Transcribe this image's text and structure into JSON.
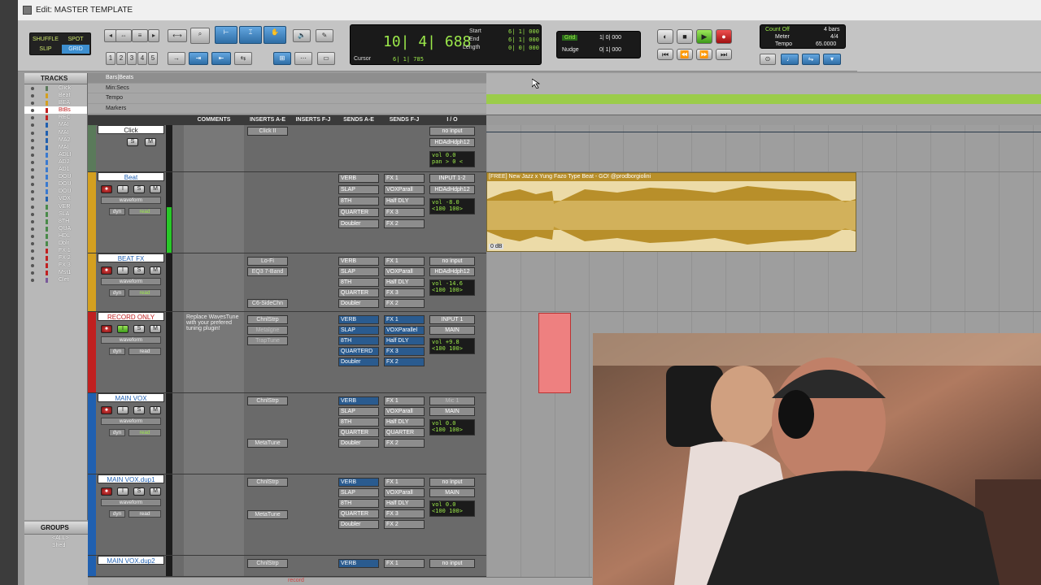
{
  "window": {
    "title": "Edit: MASTER TEMPLATE"
  },
  "modes": {
    "shuffle": "SHUFFLE",
    "spot": "SPOT",
    "slip": "SLIP",
    "grid": "GRID"
  },
  "zoom_presets": [
    "1",
    "2",
    "3",
    "4",
    "5"
  ],
  "counter": {
    "main": "10| 4| 688",
    "start_label": "Start",
    "end_label": "End",
    "length_label": "Length",
    "start": "6| 1| 000",
    "end": "6| 1| 000",
    "length": "0| 0| 000",
    "cursor_label": "Cursor",
    "cursor": "6| 1| 785"
  },
  "grid": {
    "label": "Grid",
    "value": "1| 0| 000",
    "nudge_label": "Nudge",
    "nudge_value": "0| 1| 000"
  },
  "countoff": {
    "label": "Count Off",
    "bars": "4 bars",
    "meter_label": "Meter",
    "meter": "4/4",
    "tempo_label": "Tempo",
    "tempo": "65.0000"
  },
  "tracks_panel": {
    "title": "TRACKS",
    "items": [
      "Click",
      "Beat",
      "BEA",
      "BtBs",
      "REC",
      "MAI",
      "MAI",
      "MA2",
      "MAI",
      "ADLI",
      "AD2",
      "AD1",
      "DOU",
      "DOU",
      "DOU",
      "VOX",
      "VER",
      "SLA",
      "8TH",
      "QUA",
      "HDL",
      "Dblr",
      "FX 1",
      "FX 2",
      "FX 3",
      "Mst1",
      "Clet"
    ]
  },
  "groups_panel": {
    "title": "GROUPS",
    "items": [
      "<ALL>",
      "Shed"
    ]
  },
  "rulers": [
    "Bars|Beats",
    "Min:Secs",
    "Tempo",
    "Markers"
  ],
  "columns": {
    "comments": "COMMENTS",
    "inserts_ae": "INSERTS A-E",
    "inserts_fj": "INSERTS F-J",
    "sends_ae": "SENDS A-E",
    "sends_fj": "SENDS F-J",
    "io": "I / O"
  },
  "tracks": [
    {
      "name": "Click",
      "color": "#6a6a6a",
      "comment": "",
      "inserts": [
        "Click II"
      ],
      "sends": [],
      "io_in": "no input",
      "io_out": "HDAdHdph12",
      "vol": "0.0",
      "pan": "> 0 <"
    },
    {
      "name": "Beat",
      "color": "#d4a020",
      "comment": "",
      "view": "waveform",
      "mode": "read",
      "inserts": [],
      "sends_a": [
        "VERB",
        "SLAP",
        "8TH",
        "QUARTER",
        "Doubler"
      ],
      "sends_f": [
        "FX 1",
        "VOXParall",
        "Half DLY",
        "FX 3",
        "FX 2"
      ],
      "io_in": "INPUT 1-2",
      "io_out": "HDAdHdph12",
      "vol": "-8.0",
      "pan": "<100   100>"
    },
    {
      "name": "BEAT FX",
      "color": "#d4a020",
      "comment": "",
      "view": "waveform",
      "mode": "read",
      "inserts": [
        "Lo-Fi",
        "EQ3 7-Band",
        "",
        "",
        "C6-SideChn"
      ],
      "sends_a": [
        "VERB",
        "SLAP",
        "8TH",
        "QUARTER",
        "Doubler"
      ],
      "sends_f": [
        "FX 1",
        "VOXParall",
        "Half DLY",
        "FX 3",
        "FX 2"
      ],
      "io_in": "no input",
      "io_out": "HDAdHdph12",
      "vol": "-14.6",
      "pan": "<100   100>"
    },
    {
      "name": "RECORD ONLY",
      "color": "#c02020",
      "comment": "Replace WavesTune with your prefered tuning plugin!",
      "view": "waveform",
      "mode": "read",
      "inserts": [
        "ChnlStrp",
        "Metalgne",
        "TrapTune"
      ],
      "sends_a": [
        "VERB",
        "SLAP",
        "8TH",
        "QUARTERD",
        "Doubler"
      ],
      "sends_f": [
        "FX 1",
        "VOXParallel",
        "Half DLY",
        "FX 3",
        "FX 2"
      ],
      "io_in": "INPUT 1",
      "io_out": "MAIN",
      "vol": "+9.8",
      "pan": "<100   100>"
    },
    {
      "name": "MAIN VOX",
      "color": "#2060b0",
      "comment": "",
      "view": "waveform",
      "mode": "read",
      "inserts": [
        "ChnlStrp",
        "",
        "",
        "",
        "MetaTune"
      ],
      "sends_a": [
        "VERB",
        "SLAP",
        "8TH",
        "QUARTER",
        "Doubler"
      ],
      "sends_f": [
        "FX 1",
        "VOXParall",
        "Half DLY",
        "QUARTER",
        "FX 2"
      ],
      "io_in": "Mic 1",
      "io_out": "MAIN",
      "vol": "0.0",
      "pan": "<100   100>"
    },
    {
      "name": "MAIN VOX.dup1",
      "color": "#2060b0",
      "comment": "",
      "view": "waveform",
      "mode": "read",
      "inserts": [
        "ChnlStrp",
        "",
        "",
        "MetaTune"
      ],
      "sends_a": [
        "VERB",
        "SLAP",
        "8TH",
        "QUARTER",
        "Doubler"
      ],
      "sends_f": [
        "FX 1",
        "VOXParall",
        "Half DLY",
        "FX 3",
        "FX 2"
      ],
      "io_in": "no input",
      "io_out": "MAIN",
      "vol": "0.0",
      "pan": "<100   100>"
    },
    {
      "name": "MAIN VOX.dup2",
      "color": "#2060b0",
      "comment": "",
      "inserts": [
        "ChnlStrp"
      ],
      "sends_a": [
        "VERB"
      ],
      "sends_f": [
        "FX 1"
      ],
      "io_in": "no input"
    }
  ],
  "clip": {
    "name": "[FREE] New Jazz x Yung Fazo Type Beat - GO! @prodborgiolini",
    "gain": "0 dB"
  },
  "status": {
    "record": "record"
  },
  "accent": {
    "green": "#9be84a",
    "blue": "#3d8fd0",
    "tempo_ruler": "#9bcc4a",
    "clip": "#b88f2a",
    "record": "#c02020"
  }
}
